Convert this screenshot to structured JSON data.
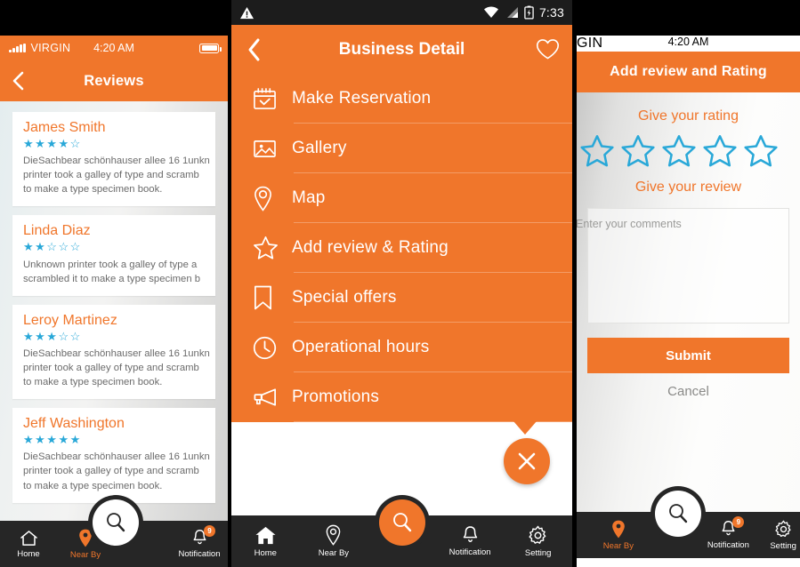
{
  "left_phone": {
    "status": {
      "carrier": "VIRGIN",
      "time": "4:20 AM",
      "icon_signal": "signal-bars-icon",
      "icon_battery": "battery-full-icon"
    },
    "appbar": {
      "title": "Reviews",
      "back_icon": "back-chevron-icon"
    },
    "reviews": [
      {
        "name": "James Smith",
        "rating": 4,
        "stars": "★★★★☆",
        "text_lines": [
          "DieSachbear schönhauser allee 16 1unkn",
          "printer took a galley of type and scramb",
          "to make a type specimen book."
        ]
      },
      {
        "name": "Linda Diaz",
        "rating": 2,
        "stars": "★★☆☆☆",
        "text_lines": [
          "Unknown printer took a galley of type a",
          "scrambled it to make a type specimen b"
        ]
      },
      {
        "name": "Leroy Martinez",
        "rating": 3,
        "stars": "★★★☆☆",
        "text_lines": [
          "DieSachbear schönhauser allee 16 1unkn",
          "printer took a galley of type and scramb",
          "to make a type specimen book."
        ]
      },
      {
        "name": "Jeff Washington",
        "rating": 5,
        "stars": "★★★★★",
        "text_lines": [
          "DieSachbear schönhauser allee 16 1unkn",
          "printer took a galley of type and scramb",
          "to make a type specimen book."
        ]
      }
    ],
    "nav": {
      "items": [
        {
          "label": "Home",
          "icon": "home-outline-icon",
          "active": false
        },
        {
          "label": "Near By",
          "icon": "map-pin-filled-icon",
          "active": true
        },
        {
          "label": "Notification",
          "icon": "bell-outline-icon",
          "active": false,
          "badge": "9"
        }
      ],
      "fab": {
        "icon": "search-icon",
        "style": "white"
      }
    }
  },
  "center_phone": {
    "status": {
      "warning_icon": "warning-triangle-icon",
      "wifi_icon": "wifi-icon",
      "signal_icon": "signal-triangle-icon",
      "battery_icon": "battery-charging-icon",
      "time": "7:33"
    },
    "appbar": {
      "title": "Business Detail",
      "back_icon": "back-chevron-icon",
      "favorite_icon": "heart-outline-icon"
    },
    "menu_items": [
      {
        "label": "Make Reservation",
        "icon": "calendar-check-icon"
      },
      {
        "label": "Gallery",
        "icon": "image-icon"
      },
      {
        "label": "Map",
        "icon": "map-pin-outline-icon"
      },
      {
        "label": "Add review & Rating",
        "icon": "star-outline-icon"
      },
      {
        "label": "Special offers",
        "icon": "bookmark-icon"
      },
      {
        "label": "Operational hours",
        "icon": "clock-icon"
      },
      {
        "label": "Promotions",
        "icon": "megaphone-icon"
      }
    ],
    "close_fab": {
      "icon": "close-x-icon"
    },
    "nav": {
      "items": [
        {
          "label": "Home",
          "icon": "home-filled-icon",
          "active": false
        },
        {
          "label": "Near By",
          "icon": "map-pin-outline-icon",
          "active": false
        },
        {
          "label": "Notification",
          "icon": "bell-outline-icon",
          "active": false
        },
        {
          "label": "Setting",
          "icon": "gear-icon",
          "active": false
        }
      ],
      "fab": {
        "icon": "search-icon",
        "style": "orange"
      }
    }
  },
  "right_phone": {
    "status": {
      "carrier": "GIN",
      "time": "4:20 AM",
      "icon_battery": "battery-full-icon"
    },
    "appbar": {
      "title": "Add review and Rating"
    },
    "rating_label": "Give your rating",
    "rating_value": 0,
    "rating_max": 5,
    "review_label": "Give your review",
    "comment_value": "",
    "comment_placeholder": "Enter your comments",
    "submit_label": "Submit",
    "cancel_label": "Cancel",
    "nav": {
      "items": [
        {
          "label": "Near By",
          "icon": "map-pin-filled-icon",
          "active": true
        },
        {
          "label": "Notification",
          "icon": "bell-outline-icon",
          "active": false,
          "badge": "9"
        },
        {
          "label": "Setting",
          "icon": "gear-icon",
          "active": false
        }
      ],
      "fab": {
        "icon": "search-icon",
        "style": "white"
      }
    }
  },
  "colors": {
    "accent": "#f0762b",
    "nav_bg": "#262626",
    "star": "#29a8d8",
    "star_off": "#bfe2f1"
  }
}
